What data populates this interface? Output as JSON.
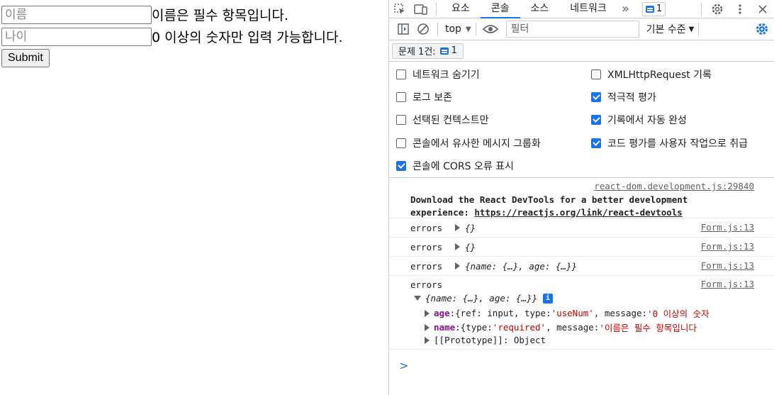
{
  "form": {
    "name_placeholder": "이름",
    "name_error": "이름은 필수 항목입니다.",
    "age_placeholder": "나이",
    "age_error": "0 이상의 숫자만 입력 가능합니다.",
    "submit_label": "Submit"
  },
  "devtools": {
    "tabs": [
      "요소",
      "콘솔",
      "소스",
      "네트워크"
    ],
    "active_tab": "콘솔",
    "issue_count_badge": "1",
    "context": "top",
    "filter_placeholder": "필터",
    "level": "기본 수준",
    "issues_label": "문제 1건:",
    "issues_count": "1",
    "settings": {
      "left": [
        {
          "label": "네트워크 숨기기",
          "checked": false
        },
        {
          "label": "로그 보존",
          "checked": false
        },
        {
          "label": "선택된 컨텍스트만",
          "checked": false
        },
        {
          "label": "콘솔에서 유사한 메시지 그룹화",
          "checked": false
        },
        {
          "label": "콘솔에 CORS 오류 표시",
          "checked": true
        }
      ],
      "right": [
        {
          "label": "XMLHttpRequest 기록",
          "checked": false
        },
        {
          "label": "적극적 평가",
          "checked": true
        },
        {
          "label": "기록에서 자동 완성",
          "checked": true
        },
        {
          "label": "코드 평가를 사용자 작업으로 취급",
          "checked": true
        }
      ]
    },
    "console": {
      "react_source": "react-dom.development.js:29840",
      "react_text": "Download the React DevTools for a better development experience: ",
      "react_link": "https://reactjs.org/link/react-devtools",
      "error_source": "Form.js:13",
      "error_label": "errors",
      "log1": "{}",
      "log2": "{}",
      "log3": "{name: {…}, age: {…}}",
      "log4_head": "{name: {…}, age: {…}}",
      "age_key": "age",
      "age_ref": "{ref: input, type: ",
      "age_type": "'useNum'",
      "age_msg_key": ", message: ",
      "age_msg": "'0 이상의 숫자",
      "name_key": "name",
      "name_type_key": "{type: ",
      "name_type": "'required'",
      "name_msg_key": ", message: ",
      "name_msg": "'이름은 필수 항목입니다",
      "proto": "[[Prototype]]: Object",
      "prompt": ">"
    }
  }
}
